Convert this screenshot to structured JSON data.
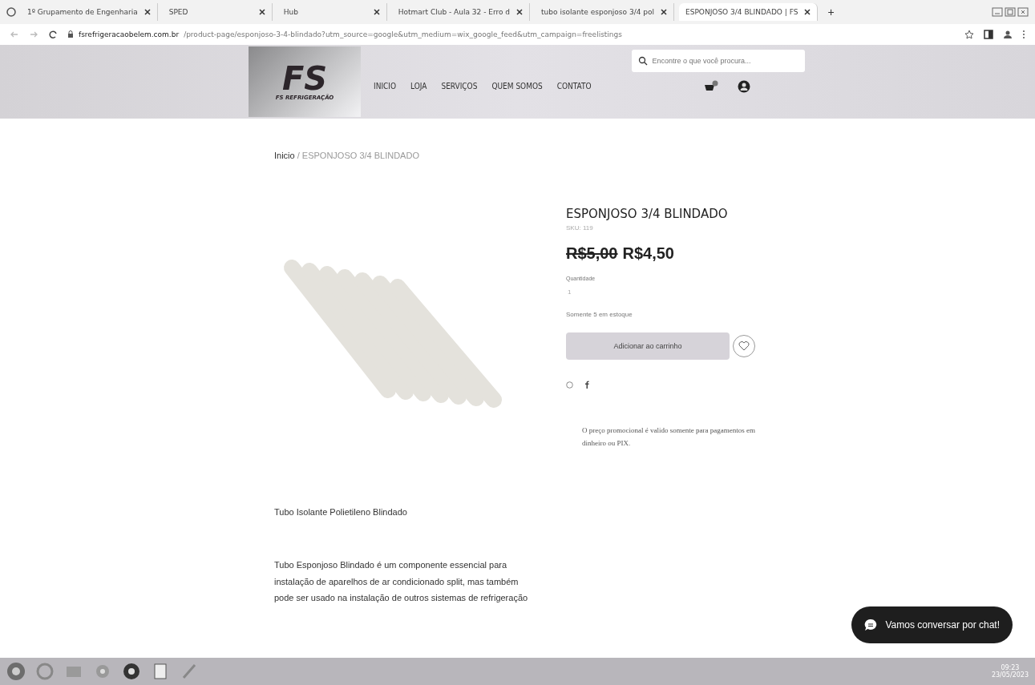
{
  "browser": {
    "tabs": [
      {
        "title": "1º Grupamento de Engenharia",
        "selected": false
      },
      {
        "title": "SPED",
        "selected": false
      },
      {
        "title": "Hub",
        "selected": false
      },
      {
        "title": "Hotmart Club - Aula 32 - Erro d",
        "selected": false
      },
      {
        "title": "tubo isolante esponjoso 3/4 pol",
        "selected": false
      },
      {
        "title": "ESPONJOSO 3/4 BLINDADO | FS",
        "selected": true
      }
    ],
    "new_tab": "+",
    "url_domain": "fsrefrigeracaobelem.com.br",
    "url_path": "/product-page/esponjoso-3-4-blindado?utm_source=google&utm_medium=wix_google_feed&utm_campaign=freelistings"
  },
  "site": {
    "logo_mark": "FS",
    "logo_text": "FS REFRIGERAÇÃO",
    "nav": [
      {
        "label": "INICIO"
      },
      {
        "label": "LOJA"
      },
      {
        "label": "SERVIÇOS"
      },
      {
        "label": "QUEM SOMOS"
      },
      {
        "label": "CONTATO"
      }
    ],
    "search": {
      "placeholder": "Encontre o que você procura..."
    }
  },
  "breadcrumb": {
    "home": "Inicio",
    "current": "/ ESPONJOSO 3/4 BLINDADO"
  },
  "product": {
    "name": "ESPONJOSO 3/4 BLINDADO",
    "sku": "SKU: 119",
    "old_price": "R$5,00",
    "price": "R$4,50",
    "quantity_label": "Quantidade",
    "quantity": "1",
    "stock": "Somente 5 em estoque",
    "add_button": "Adicionar ao carrinho",
    "note": "O preço promocional é valido somente para pagamentos em dinheiro ou PIX."
  },
  "description": {
    "title": "Tubo Isolante Polietileno Blindado",
    "lines": [
      "Tubo Esponjoso Blindado é um componente essencial para",
      "instalação de aparelhos de ar condicionado split, mas também",
      "pode ser usado na instalação de outros sistemas de refrigeração"
    ]
  },
  "chat_button": "Vamos conversar por chat!",
  "taskbar": {
    "time": "09:23",
    "date": "23/05/2023"
  }
}
